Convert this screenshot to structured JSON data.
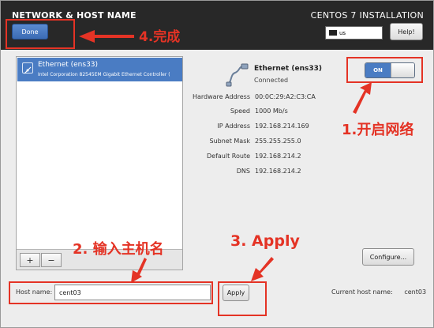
{
  "header": {
    "title": "NETWORK & HOST NAME",
    "install_title": "CENTOS 7 INSTALLATION",
    "done_label": "Done",
    "keyboard_layout": "us",
    "help_label": "Help!"
  },
  "device_list": {
    "items": [
      {
        "name": "Ethernet (ens33)",
        "description": "Intel Corporation 82545EM Gigabit Ethernet Controller ("
      }
    ],
    "add_label": "+",
    "remove_label": "−"
  },
  "device": {
    "name": "Ethernet (ens33)",
    "status": "Connected",
    "toggle_label": "ON",
    "details": [
      {
        "label": "Hardware Address",
        "value": "00:0C:29:A2:C3:CA"
      },
      {
        "label": "Speed",
        "value": "1000 Mb/s"
      },
      {
        "label": "IP Address",
        "value": "192.168.214.169"
      },
      {
        "label": "Subnet Mask",
        "value": "255.255.255.0"
      },
      {
        "label": "Default Route",
        "value": "192.168.214.2"
      },
      {
        "label": "DNS",
        "value": "192.168.214.2"
      }
    ],
    "configure_label": "Configure..."
  },
  "hostname": {
    "label": "Host name:",
    "value": "cent03",
    "apply_label": "Apply",
    "current_label": "Current host name:",
    "current_value": "cent03"
  },
  "annotations": {
    "step1": "1.开启网络",
    "step2": "2. 输入主机名",
    "step3": "3. Apply",
    "step4": "4.完成",
    "color": "#e43325"
  },
  "colors": {
    "header_bg": "#282828",
    "accent": "#4a7cc3",
    "window_bg": "#ededed"
  }
}
